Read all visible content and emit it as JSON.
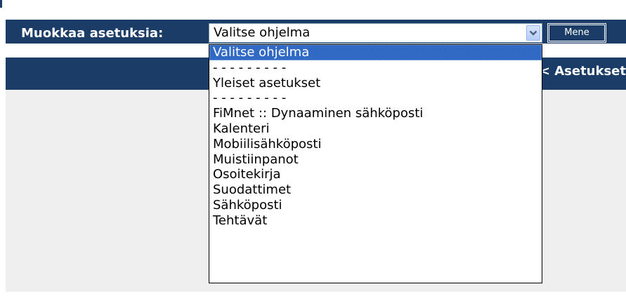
{
  "header": {
    "label": "Muokkaa asetuksia:",
    "select_value": "Valitse ohjelma",
    "go_button": "Mene"
  },
  "nav_bar": {
    "link_text": "Asetukset >>"
  },
  "dropdown": {
    "options": [
      "Valitse ohjelma",
      "- - - - - - - - -",
      "Yleiset asetukset",
      "- - - - - - - - -",
      "FiMnet :: Dynaaminen sähköposti",
      "Kalenteri",
      "Mobiilisähköposti",
      "Muistiinpanot",
      "Osoitekirja",
      "Suodattimet",
      "Sähköposti",
      "Tehtävät"
    ],
    "selected_index": 0
  },
  "colors": {
    "header_bg": "#1b3c67",
    "selection": "#316ac5",
    "content_bg": "#efefef"
  }
}
